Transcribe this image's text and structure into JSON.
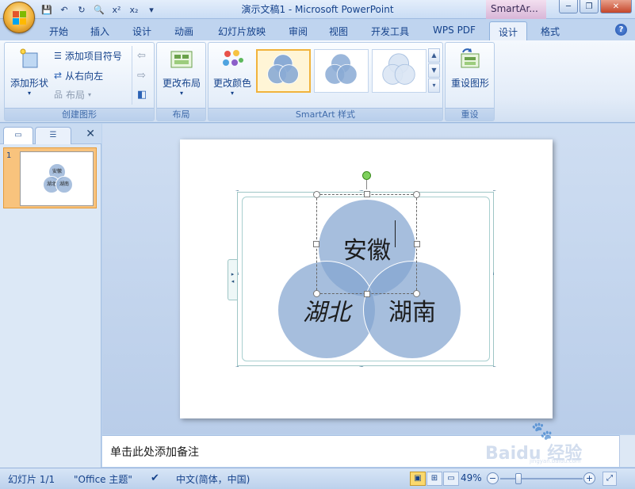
{
  "window": {
    "title": "演示文稿1 - Microsoft PowerPoint",
    "context_tab_title": "SmartAr..."
  },
  "tabs": [
    {
      "label": "开始",
      "active": false
    },
    {
      "label": "插入",
      "active": false
    },
    {
      "label": "设计",
      "active": false
    },
    {
      "label": "动画",
      "active": false
    },
    {
      "label": "幻灯片放映",
      "active": false
    },
    {
      "label": "审阅",
      "active": false
    },
    {
      "label": "视图",
      "active": false
    },
    {
      "label": "开发工具",
      "active": false
    },
    {
      "label": "WPS PDF",
      "active": false
    },
    {
      "label": "设计",
      "active": true
    },
    {
      "label": "格式",
      "active": false
    }
  ],
  "ribbon": {
    "create_graphic": {
      "label": "创建图形",
      "add_shape": "添加形状",
      "add_bullet": "添加项目符号",
      "right_to_left": "从右向左",
      "layout": "布局"
    },
    "layouts": {
      "label": "布局",
      "change_layout": "更改布局"
    },
    "styles": {
      "label": "SmartArt 样式",
      "change_colors": "更改颜色"
    },
    "reset": {
      "label": "重设",
      "reset_graphic": "重设图形"
    }
  },
  "slide": {
    "number": "1",
    "venn": [
      "安徽",
      "湖北",
      "湖南"
    ]
  },
  "notes": {
    "placeholder": "单击此处添加备注"
  },
  "status": {
    "slide": "幻灯片 1/1",
    "theme": "\"Office 主题\"",
    "language": "中文(简体，中国)",
    "zoom": "49%"
  },
  "watermark": {
    "text": "Baidu 经验",
    "sub": "jingyan.baidu.com"
  },
  "colors": {
    "venn_fill": "#84a5d0",
    "ribbon_text": "#15428b",
    "selected_thumb": "#f8c37d",
    "rotate_handle": "#7ed05c"
  }
}
